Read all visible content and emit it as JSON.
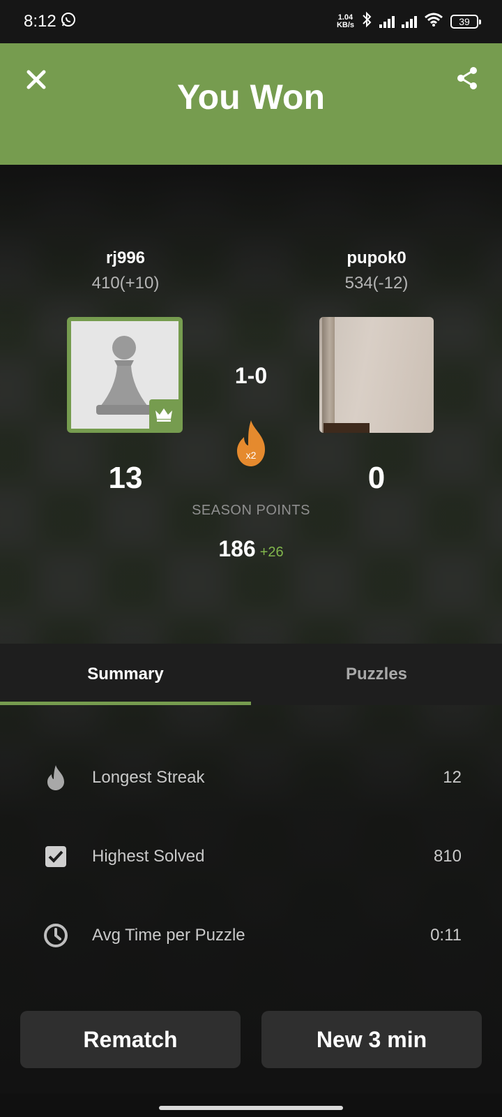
{
  "status_bar": {
    "time": "8:12",
    "net_speed_value": "1.04",
    "net_speed_unit": "KB/s",
    "battery": "39"
  },
  "header": {
    "title": "You Won",
    "bg_color": "#769c4f"
  },
  "players": {
    "me": {
      "name": "rj996",
      "rating": "410(+10)",
      "points": "13"
    },
    "opponent": {
      "name": "pupok0",
      "rating": "534(-12)",
      "points": "0"
    }
  },
  "match": {
    "score": "1-0",
    "multiplier": "x2"
  },
  "season": {
    "label": "SEASON POINTS",
    "points": "186",
    "delta": "+26"
  },
  "tabs": [
    {
      "label": "Summary",
      "active": true
    },
    {
      "label": "Puzzles",
      "active": false
    }
  ],
  "summary": [
    {
      "icon": "flame-icon",
      "label": "Longest Streak",
      "value": "12"
    },
    {
      "icon": "checkbox-icon",
      "label": "Highest Solved",
      "value": "810"
    },
    {
      "icon": "clock-icon",
      "label": "Avg Time per Puzzle",
      "value": "0:11"
    }
  ],
  "buttons": {
    "rematch": "Rematch",
    "new_game": "New 3 min"
  },
  "colors": {
    "accent_green": "#769c4f",
    "delta_green": "#81b64c",
    "flame_orange": "#e58a2e"
  }
}
